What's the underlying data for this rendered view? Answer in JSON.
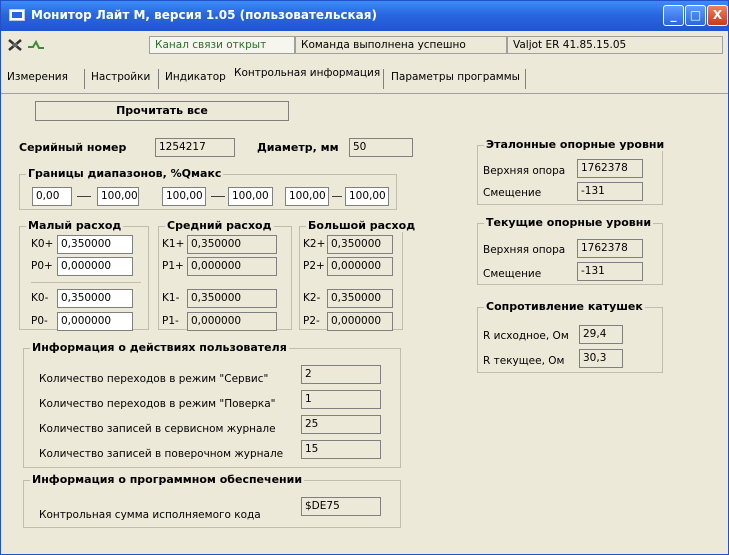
{
  "window": {
    "title": "Монитор Лайт М, версия 1.05 (пользовательская)",
    "app_icon": "monitor-icon"
  },
  "caption_buttons": {
    "minimize": "_",
    "maximize": "□",
    "close": "X"
  },
  "toolbar": {
    "channel_status": "Канал связи открыт",
    "command_status": "Команда выполнена успешно",
    "device_version": "Valjot ER 41.85.15.05",
    "icons": [
      "disconnect-icon",
      "connect-icon"
    ]
  },
  "tabs": [
    "Измерения",
    "Настройки",
    "Индикатор",
    "Контрольная информация",
    "Параметры программы"
  ],
  "read_all_label": "Прочитать все",
  "serial": {
    "label": "Серийный номер",
    "value": "1254217"
  },
  "diameter": {
    "label": "Диаметр, мм",
    "value": "50"
  },
  "ranges": {
    "title": "Границы диапазонов, %Qмакс",
    "pairs": [
      [
        "0,00",
        "100,00"
      ],
      [
        "100,00",
        "100,00"
      ],
      [
        "100,00",
        "100,00"
      ]
    ]
  },
  "small": {
    "title": "Малый расход",
    "k_plus_label": "K0+",
    "k_plus": "0,350000",
    "p_plus_label": "P0+",
    "p_plus": "0,000000",
    "k_minus_label": "K0-",
    "k_minus": "0,350000",
    "p_minus_label": "P0-",
    "p_minus": "0,000000"
  },
  "medium": {
    "title": "Средний расход",
    "k_plus_label": "K1+",
    "k_plus": "0,350000",
    "p_plus_label": "P1+",
    "p_plus": "0,000000",
    "k_minus_label": "K1-",
    "k_minus": "0,350000",
    "p_minus_label": "P1-",
    "p_minus": "0,000000"
  },
  "large": {
    "title": "Большой расход",
    "k_plus_label": "K2+",
    "k_plus": "0,350000",
    "p_plus_label": "P2+",
    "p_plus": "0,000000",
    "k_minus_label": "K2-",
    "k_minus": "0,350000",
    "p_minus_label": "P2-",
    "p_minus": "0,000000"
  },
  "user_info": {
    "title": "Информация о действиях пользователя",
    "rows": [
      {
        "label": "Количество переходов в режим \"Сервис\"",
        "value": "2"
      },
      {
        "label": "Количество переходов в режим \"Поверка\"",
        "value": "1"
      },
      {
        "label": "Количество записей в сервисном журнале",
        "value": "25"
      },
      {
        "label": "Количество записей в поверочном журнале",
        "value": "15"
      }
    ]
  },
  "software_info": {
    "title": "Информация о программном обеспечении",
    "checksum_label": "Контрольная сумма исполняемого кода",
    "checksum": "$DE75"
  },
  "reference_levels": {
    "title": "Эталонные опорные уровни",
    "upper_label": "Верхняя опора",
    "upper": "1762378",
    "offset_label": "Смещение",
    "offset": "-131"
  },
  "current_levels": {
    "title": "Текущие опорные уровни",
    "upper_label": "Верхняя опора",
    "upper": "1762378",
    "offset_label": "Смещение",
    "offset": "-131"
  },
  "coils": {
    "title": "Сопротивление катушек",
    "initial_label": "R исходное, Ом",
    "initial": "29,4",
    "current_label": "R текущее, Ом",
    "current": "30,3"
  },
  "colors": {
    "titlebar": "#2a66e0",
    "face": "#ece9d8",
    "status_green": "#2b6e2b"
  }
}
